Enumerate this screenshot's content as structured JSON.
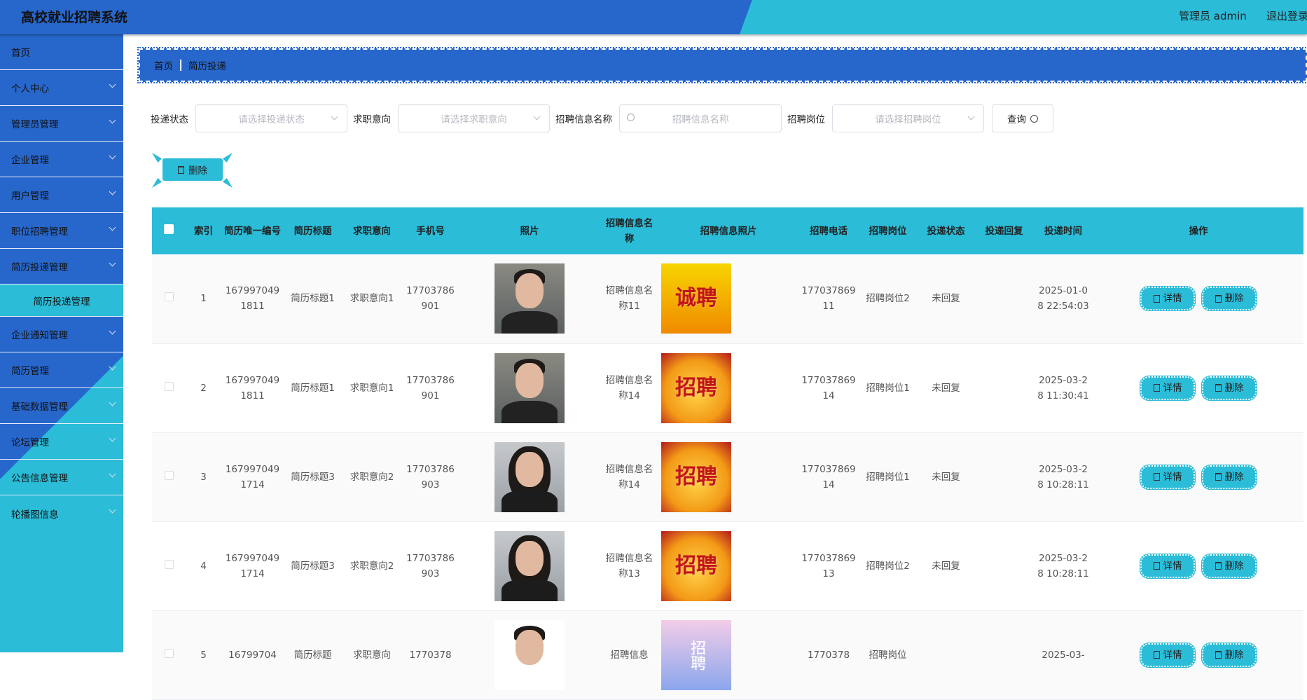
{
  "header": {
    "title": "高校就业招聘系统",
    "user": "管理员 admin",
    "logout": "退出登录"
  },
  "sidebar": {
    "items": [
      {
        "label": "首页",
        "chevron": false
      },
      {
        "label": "个人中心",
        "chevron": true
      },
      {
        "label": "管理员管理",
        "chevron": true
      },
      {
        "label": "企业管理",
        "chevron": true
      },
      {
        "label": "用户管理",
        "chevron": true
      },
      {
        "label": "职位招聘管理",
        "chevron": true
      },
      {
        "label": "简历投递管理",
        "chevron": true
      },
      {
        "label": "简历投递管理",
        "sub": true
      },
      {
        "label": "企业通知管理",
        "chevron": true
      },
      {
        "label": "简历管理",
        "chevron": true
      },
      {
        "label": "基础数据管理",
        "chevron": true
      },
      {
        "label": "论坛管理",
        "chevron": true
      },
      {
        "label": "公告信息管理",
        "chevron": true
      },
      {
        "label": "轮播图信息",
        "chevron": true
      }
    ]
  },
  "breadcrumb": {
    "home": "首页",
    "current": "简历投递"
  },
  "filters": {
    "status_label": "投递状态",
    "status_placeholder": "请选择投递状态",
    "intent_label": "求职意向",
    "intent_placeholder": "请选择求职意向",
    "name_label": "招聘信息名称",
    "name_placeholder": "招聘信息名称",
    "position_label": "招聘岗位",
    "position_placeholder": "请选择招聘岗位",
    "query_button": "查询"
  },
  "toolbar": {
    "delete_label": "删除"
  },
  "table": {
    "columns": [
      "",
      "索引",
      "简历唯一编号",
      "简历标题",
      "求职意向",
      "手机号",
      "照片",
      "招聘信息名称",
      "招聘信息照片",
      "招聘电话",
      "招聘岗位",
      "投递状态",
      "投递回复",
      "投递时间",
      "操作"
    ],
    "detail_label": "详情",
    "delete_label": "删除",
    "rows": [
      {
        "index": "1",
        "uid": "1679970491811",
        "title": "简历标题1",
        "intent": "求职意向1",
        "phone": "17703786901",
        "photo": "male-1",
        "info_name": "招聘信息名称11",
        "poster": "诚聘",
        "poster_style": "a",
        "rec_phone": "17703786911",
        "position": "招聘岗位2",
        "status": "未回复",
        "reply": "",
        "time": "2025-01-08 22:54:03"
      },
      {
        "index": "2",
        "uid": "1679970491811",
        "title": "简历标题1",
        "intent": "求职意向1",
        "phone": "17703786901",
        "photo": "male-1",
        "info_name": "招聘信息名称14",
        "poster": "招聘",
        "poster_style": "b",
        "rec_phone": "17703786914",
        "position": "招聘岗位1",
        "status": "未回复",
        "reply": "",
        "time": "2025-03-28 11:30:41"
      },
      {
        "index": "3",
        "uid": "1679970491714",
        "title": "简历标题3",
        "intent": "求职意向2",
        "phone": "17703786903",
        "photo": "female",
        "info_name": "招聘信息名称14",
        "poster": "招聘",
        "poster_style": "b",
        "rec_phone": "17703786914",
        "position": "招聘岗位1",
        "status": "未回复",
        "reply": "",
        "time": "2025-03-28 10:28:11"
      },
      {
        "index": "4",
        "uid": "1679970491714",
        "title": "简历标题3",
        "intent": "求职意向2",
        "phone": "17703786903",
        "photo": "female",
        "info_name": "招聘信息名称13",
        "poster": "招聘",
        "poster_style": "b",
        "rec_phone": "17703786913",
        "position": "招聘岗位2",
        "status": "未回复",
        "reply": "",
        "time": "2025-03-28 10:28:11"
      },
      {
        "index": "5",
        "uid": "16799704",
        "title": "简历标题",
        "intent": "求职意向",
        "phone": "1770378",
        "photo": "male-2",
        "info_name": "招聘信息",
        "poster": "招聘",
        "poster_style": "p",
        "rec_phone": "1770378",
        "position": "招聘岗位",
        "status": "",
        "reply": "",
        "time": "2025-03-"
      }
    ]
  },
  "colors": {
    "primary": "#2767cc",
    "accent": "#2bbcd8"
  }
}
